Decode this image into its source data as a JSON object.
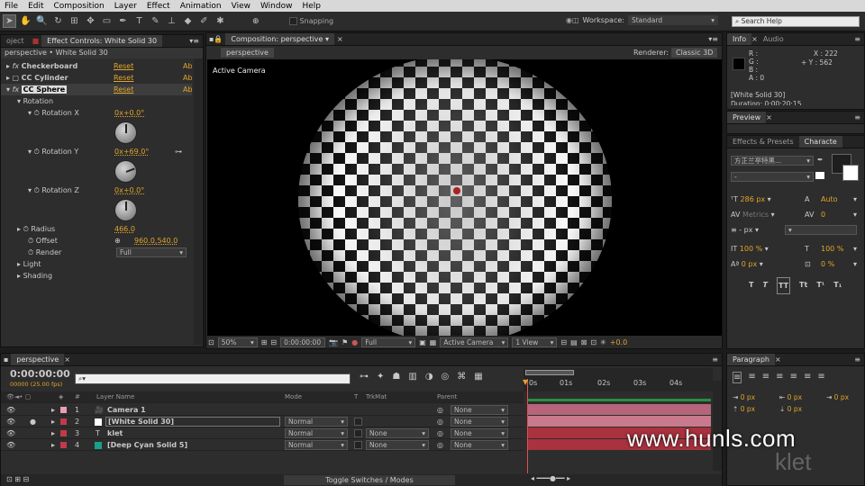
{
  "menu": [
    "File",
    "Edit",
    "Composition",
    "Layer",
    "Effect",
    "Animation",
    "View",
    "Window",
    "Help"
  ],
  "toolbar": {
    "snapping_label": "Snapping",
    "workspace_label": "Workspace:",
    "workspace_value": "Standard",
    "search_placeholder": "Search Help"
  },
  "left_panel": {
    "tab_project": "oject",
    "tab_effect": "Effect Controls: White Solid 30",
    "breadcrumb": "perspective • White Solid 30",
    "effects": [
      {
        "name": "Checkerboard",
        "reset": "Reset",
        "about": "Ab"
      },
      {
        "name": "CC Cylinder",
        "reset": "Reset",
        "about": "Ab"
      },
      {
        "name": "CC Sphere",
        "reset": "Reset",
        "about": "Ab"
      }
    ],
    "rotation_label": "Rotation",
    "rot_x_label": "Rotation X",
    "rot_x_value": "0x+0.0°",
    "rot_y_label": "Rotation Y",
    "rot_y_value": "0x+69.0°",
    "rot_z_label": "Rotation Z",
    "rot_z_value": "0x+0.0°",
    "radius_label": "Radius",
    "radius_value": "466.0",
    "offset_label": "Offset",
    "offset_value": "960.0,540.0",
    "render_label": "Render",
    "render_value": "Full",
    "light_label": "Light",
    "shading_label": "Shading"
  },
  "comp_panel": {
    "tab": "Composition: perspective",
    "comp_tab": "perspective",
    "renderer_label": "Renderer:",
    "renderer_value": "Classic 3D",
    "active_camera": "Active Camera",
    "zoom": "50%",
    "timecode": "0:00:00:00",
    "resolution": "Full",
    "camera": "Active Camera",
    "views": "1 View",
    "exposure": "+0.0"
  },
  "info_panel": {
    "tab_info": "Info",
    "tab_audio": "Audio",
    "r": "R :",
    "g": "G :",
    "b": "B :",
    "a": "A : 0",
    "x": "X : 222",
    "y": "+ Y : 562",
    "layer": "[White Solid 30]",
    "duration": "Duration: 0:00:20:15"
  },
  "preview_panel": {
    "tab": "Preview"
  },
  "char_panel": {
    "tab_effects": "Effects & Presets",
    "tab_char": "Characte",
    "font": "方正兰亭特黑...",
    "style": "-",
    "size": "286 px",
    "leading": "Auto",
    "kerning": "Metrics",
    "tracking": "0",
    "stroke": "- px",
    "vscale": "100 %",
    "hscale": "100 %",
    "baseline": "0 px",
    "tsume": "0 %",
    "styles": [
      "T",
      "T",
      "TT",
      "Tt",
      "T¹",
      "T₁"
    ]
  },
  "timeline": {
    "tab": "perspective",
    "timecode": "0:00:00:00",
    "fps": "00000 (25.00 fps)",
    "headers": {
      "num": "#",
      "name": "Layer Name",
      "mode": "Mode",
      "t": "T",
      "trkmat": "TrkMat",
      "parent": "Parent"
    },
    "ruler": [
      "0s",
      "01s",
      "02s",
      "03s",
      "04s"
    ],
    "toggle": "Toggle Switches / Modes",
    "layers": [
      {
        "num": "1",
        "name": "Camera 1",
        "mode": "",
        "trkmat": "",
        "parent": "None",
        "color": "#e8a0b0"
      },
      {
        "num": "2",
        "name": "[White Solid 30]",
        "mode": "Normal",
        "trkmat": "",
        "parent": "None",
        "color": "#ffffff"
      },
      {
        "num": "3",
        "name": "klet",
        "mode": "Normal",
        "trkmat": "None",
        "parent": "None",
        "color": "#c23a4a"
      },
      {
        "num": "4",
        "name": "[Deep Cyan Solid 5]",
        "mode": "Normal",
        "trkmat": "None",
        "parent": "None",
        "color": "#1aa08c"
      }
    ]
  },
  "paragraph": {
    "tab": "Paragraph",
    "vals": [
      "0 px",
      "0 px",
      "0 px",
      "0 px",
      "0 px"
    ]
  },
  "watermark": "www.hunls.com",
  "watermark2": "klet"
}
